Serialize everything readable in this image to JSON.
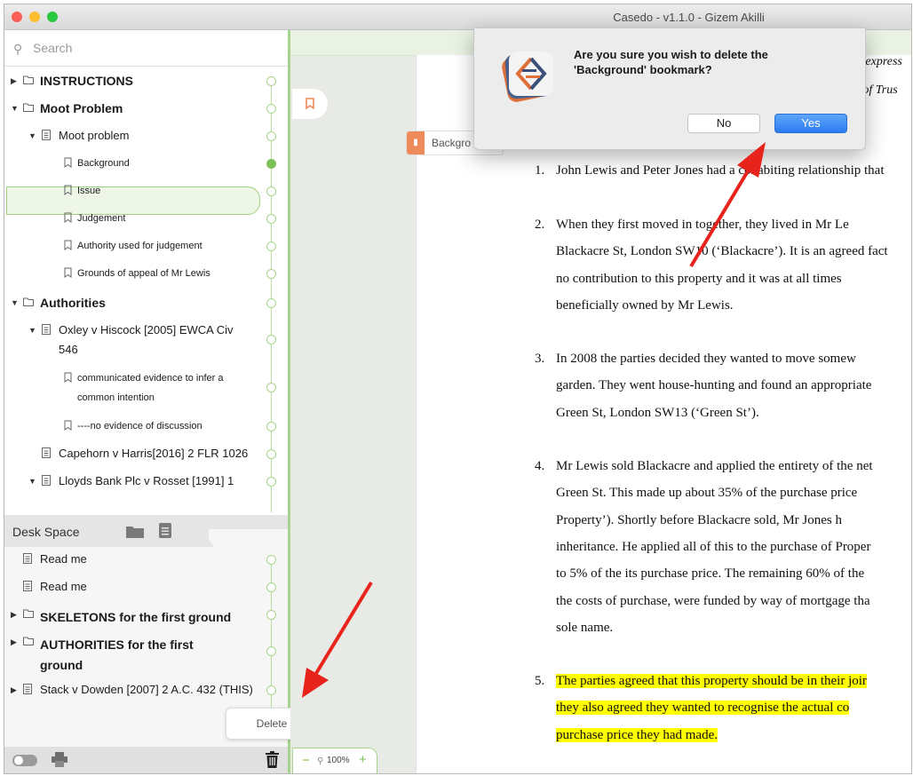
{
  "window": {
    "title": "Casedo - v1.1.0 - Gizem Akilli"
  },
  "sidebar": {
    "search_placeholder": "Search",
    "tree": [
      {
        "label": "INSTRUCTIONS",
        "level": 0,
        "type": "folder",
        "collapsed": true
      },
      {
        "label": "Moot Problem",
        "level": 0,
        "type": "folder",
        "collapsed": false
      },
      {
        "label": "Moot problem",
        "level": 1,
        "type": "document",
        "collapsed": false
      },
      {
        "label": "Background",
        "level": 2,
        "type": "bookmark",
        "selected": true
      },
      {
        "label": "Issue",
        "level": 2,
        "type": "bookmark"
      },
      {
        "label": "Judgement",
        "level": 2,
        "type": "bookmark"
      },
      {
        "label": "Authority used for judgement",
        "level": 2,
        "type": "bookmark"
      },
      {
        "label": "Grounds of appeal of Mr Lewis",
        "level": 2,
        "type": "bookmark"
      },
      {
        "label": "Authorities",
        "level": 0,
        "type": "folder",
        "collapsed": false
      },
      {
        "label": "Oxley v Hiscock [2005] EWCA Civ",
        "label2": "546",
        "level": 1,
        "type": "document",
        "collapsed": false
      },
      {
        "label": "communicated evidence to infer a",
        "label2": "common intention",
        "level": 2,
        "type": "bookmark"
      },
      {
        "label": "----no evidence of discussion",
        "level": 2,
        "type": "bookmark"
      },
      {
        "label": "Capehorn v Harris[2016] 2 FLR 1026",
        "level": 1,
        "type": "document"
      },
      {
        "label": "Lloyds Bank Plc v Rosset [1991] 1",
        "level": 1,
        "type": "document",
        "collapsed": false
      }
    ],
    "desk_space": {
      "label": "Desk Space",
      "items": [
        {
          "label": "Read me",
          "type": "document",
          "bold": false
        },
        {
          "label": "Read me",
          "type": "document",
          "bold": false
        },
        {
          "label": "SKELETONS for the first ground",
          "type": "folder",
          "bold": true
        },
        {
          "label": "AUTHORITIES for the first",
          "label2": "ground",
          "type": "folder",
          "bold": true
        },
        {
          "label": "Stack v Dowden [2007] 2 A.C. 432 (THIS)",
          "type": "document",
          "bold": false
        }
      ]
    },
    "tooltip": "Delete"
  },
  "document": {
    "bookmark_tag": "Backgro",
    "zoom": "100%",
    "partial_top": [
      "ut express",
      "t of Trus"
    ],
    "paragraphs": [
      {
        "num": "1.",
        "lines": [
          "John Lewis and Peter Jones had a cohabiting relationship that"
        ],
        "highlight": false
      },
      {
        "num": "2.",
        "lines": [
          "When they first moved in together, they lived in Mr Le",
          "Blackacre St, London SW10 (‘Blackacre’). It is an agreed fact",
          "no contribution to this property and it was at all times",
          "beneficially owned by Mr Lewis."
        ],
        "highlight": false
      },
      {
        "num": "3.",
        "lines": [
          "In 2008 the parties decided they wanted to move somew",
          "garden. They went house-hunting and found an appropriate",
          "Green St, London SW13 (‘Green St’)."
        ],
        "highlight": false
      },
      {
        "num": "4.",
        "lines": [
          "Mr Lewis sold Blackacre and applied the entirety of the net",
          "Green St. This made up about 35% of the purchase price",
          "Property’).  Shortly before Blackacre sold, Mr Jones h",
          "inheritance. He applied all of this to the purchase of Proper",
          "to 5% of the its purchase price.  The remaining 60% of the",
          "the costs of purchase, were funded by way of mortgage tha",
          "sole name."
        ],
        "highlight": false
      },
      {
        "num": "5.",
        "lines": [
          "The parties agreed that this property should be in their joir",
          "they also agreed they wanted to recognise the actual co",
          "purchase price they had made."
        ],
        "highlight": true
      }
    ]
  },
  "dialog": {
    "message_line1": "Are you sure you wish to delete the",
    "message_line2": "'Background' bookmark?",
    "no_label": "No",
    "yes_label": "Yes"
  },
  "colors": {
    "accent_green": "#a7d48c",
    "yes_button": "#2c7cf0",
    "highlight": "#ffff00",
    "bookmark_orange": "#ef8a5a",
    "arrow": "#e8231b"
  }
}
